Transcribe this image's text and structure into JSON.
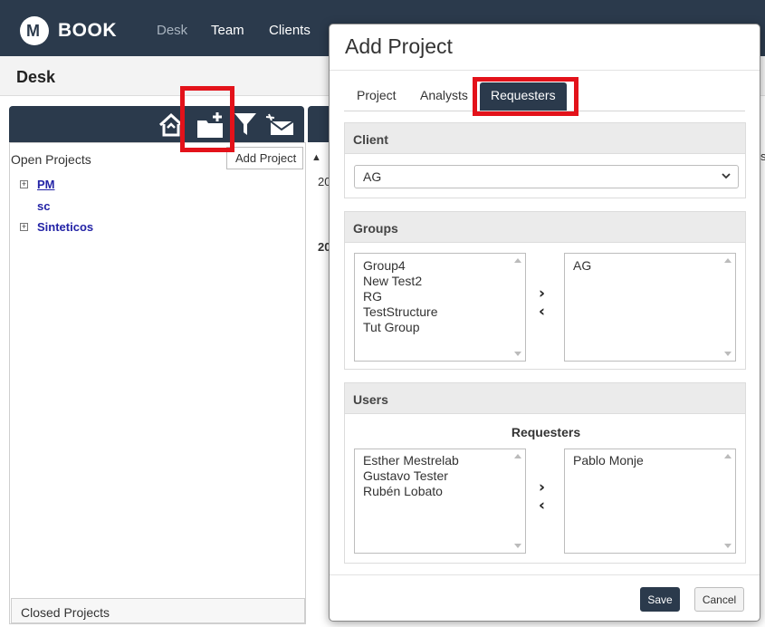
{
  "app": {
    "logo_text": "BOOK",
    "logo_letter": "M"
  },
  "nav": {
    "items": [
      "Desk",
      "Team",
      "Clients"
    ]
  },
  "page": {
    "title": "Desk"
  },
  "left_panel": {
    "toolbar_icons": [
      "home-icon",
      "add-folder-icon",
      "filter-icon",
      "mail-icon"
    ],
    "open_projects_label": "Open Projects",
    "tooltip": "Add Project",
    "tree": [
      {
        "label": "PM",
        "expandable": true
      },
      {
        "label": "sc",
        "expandable": false
      },
      {
        "label": "Sinteticos",
        "expandable": true
      }
    ],
    "closed_projects_label": "Closed Projects"
  },
  "background_fragments": {
    "row1": "20",
    "row2": "20",
    "sort_arrow": "▲",
    "s": "s"
  },
  "dialog": {
    "title": "Add Project",
    "tabs": [
      "Project",
      "Analysts",
      "Requesters"
    ],
    "active_tab": "Requesters",
    "client": {
      "label": "Client",
      "value": "AG"
    },
    "groups": {
      "label": "Groups",
      "available": [
        "Group4",
        "New Test2",
        "RG",
        "TestStructure",
        "Tut Group"
      ],
      "selected": [
        "AG"
      ],
      "move_right": "›",
      "move_left": "‹"
    },
    "users": {
      "label": "Users",
      "sublabel": "Requesters",
      "available": [
        "Esther Mestrelab",
        "Gustavo Tester",
        "Rubén Lobato"
      ],
      "selected": [
        "Pablo Monje"
      ],
      "move_right": "›",
      "move_left": "‹"
    },
    "save_label": "Save",
    "cancel_label": "Cancel"
  },
  "colors": {
    "navbar": "#2b3a4c",
    "highlight": "#e3121a",
    "tree_link": "#2323a6"
  }
}
